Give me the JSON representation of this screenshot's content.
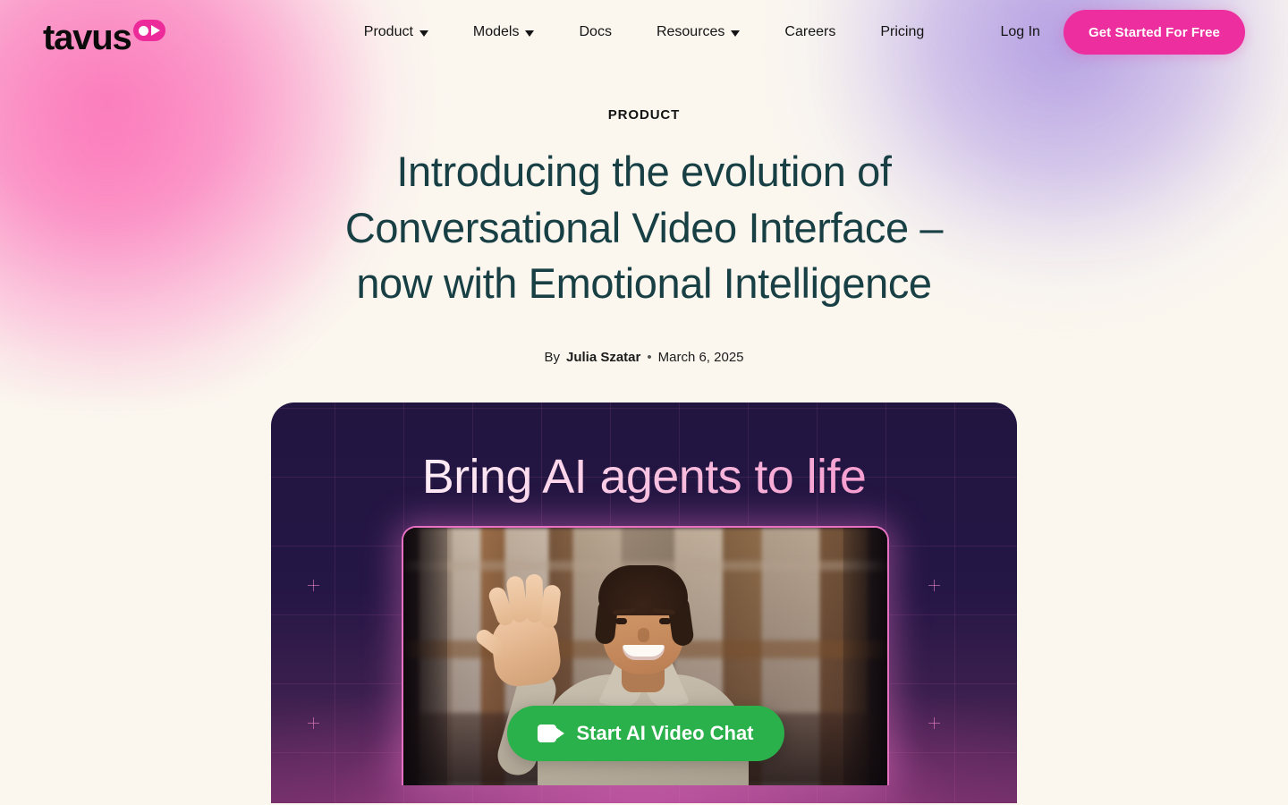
{
  "brand": {
    "name": "tavus",
    "logo_mark_icon": "play-pill-icon",
    "accent_pink": "#ED2E9E",
    "heading_teal": "#173F44",
    "page_background": "#FBF7EF"
  },
  "nav": {
    "items": [
      {
        "label": "Product",
        "has_dropdown": true,
        "icon": "chevron-down-icon"
      },
      {
        "label": "Models",
        "has_dropdown": true,
        "icon": "chevron-down-icon"
      },
      {
        "label": "Docs",
        "has_dropdown": false,
        "icon": ""
      },
      {
        "label": "Resources",
        "has_dropdown": true,
        "icon": "chevron-down-icon"
      },
      {
        "label": "Careers",
        "has_dropdown": false,
        "icon": ""
      },
      {
        "label": "Pricing",
        "has_dropdown": false,
        "icon": ""
      }
    ],
    "login_label": "Log In",
    "cta_label": "Get Started For Free"
  },
  "article": {
    "eyebrow": "PRODUCT",
    "headline": "Introducing the evolution of Conversational Video Interface – now with Emotional Intelligence",
    "byline_prefix": "By",
    "author": "Julia Szatar",
    "separator": "•",
    "date": "March 6, 2025"
  },
  "hero": {
    "title": "Bring AI agents to life",
    "card_background_dark": "#221540",
    "card_background_glow": "#6B2F63",
    "video_border_color": "#E871C4",
    "cta": {
      "label": "Start AI Video Chat",
      "icon": "video-camera-icon",
      "color": "#2BB14B"
    },
    "video_alt": "Smiling young man with curly dark hair waving at the camera in a warm-toned interior"
  }
}
